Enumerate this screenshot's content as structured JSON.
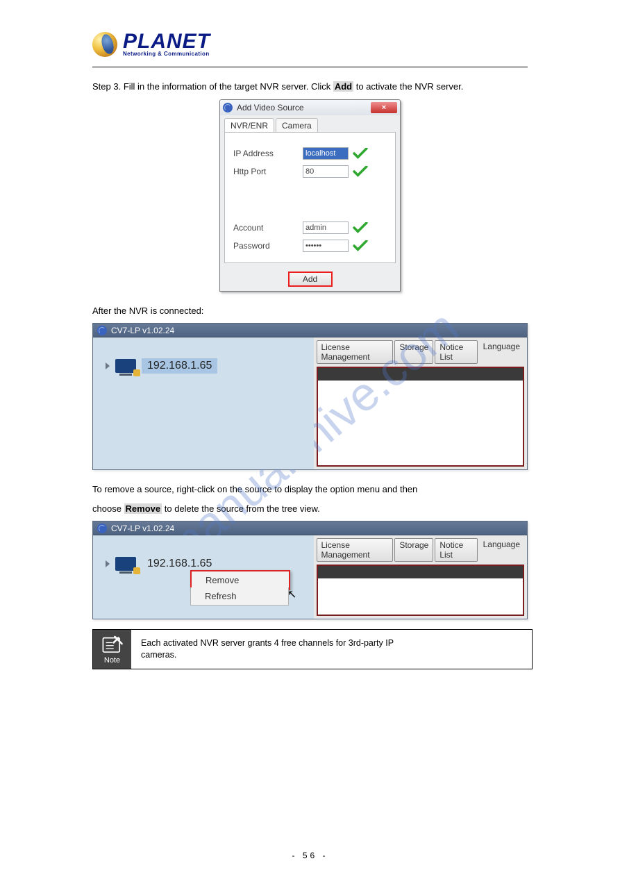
{
  "logo": {
    "title": "PLANET",
    "subtitle": "Networking & Communication"
  },
  "intro": {
    "step": "Step 3.",
    "text_a": "Fill in the information of the target NVR server. Click ",
    "add_word": "Add",
    "text_b": " to activate the NVR server."
  },
  "avs": {
    "title": "Add Video Source",
    "close": "×",
    "tabs": {
      "active": "NVR/ENR",
      "inactive": "Camera"
    },
    "fields": {
      "ip_label": "IP Address",
      "ip_value": "localhost",
      "port_label": "Http Port",
      "port_value": "80",
      "acct_label": "Account",
      "acct_value": "admin",
      "pwd_label": "Password",
      "pwd_value": "••••••"
    },
    "add_btn": "Add"
  },
  "after_add": "After the NVR is connected:",
  "cv": {
    "title": "CV7-LP v1.02.24",
    "ip": "192.168.1.65",
    "tabs": {
      "lm": "License Management",
      "st": "Storage",
      "nl": "Notice List",
      "lang": "Language"
    }
  },
  "remove": {
    "p1": "To remove a source, right-click on the source to display the option menu and then",
    "p2a": "choose ",
    "remove_word": "Remove",
    "p2b": " to delete the source from the tree view."
  },
  "ctx": {
    "remove": "Remove",
    "refresh": "Refresh"
  },
  "note": {
    "label": "Note",
    "line1": "Each activated NVR server grants 4 free channels for 3rd-party IP",
    "line2": "cameras."
  },
  "watermark": "manualshive.com",
  "pagenum": "- 56 -"
}
